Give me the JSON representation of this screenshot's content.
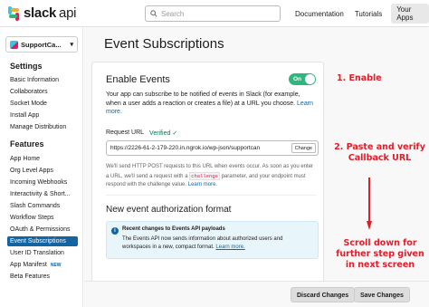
{
  "brand": {
    "name": "slack",
    "suffix": "api"
  },
  "search": {
    "placeholder": "Search"
  },
  "nav": {
    "documentation": "Documentation",
    "tutorials": "Tutorials",
    "your_apps": "Your Apps"
  },
  "app_selector": {
    "name": "SupportCa..."
  },
  "sidebar": {
    "settings_heading": "Settings",
    "settings_items": [
      "Basic Information",
      "Collaborators",
      "Socket Mode",
      "Install App",
      "Manage Distribution"
    ],
    "features_heading": "Features",
    "features_items": [
      "App Home",
      "Org Level Apps",
      "Incoming Webhooks",
      "Interactivity & Short...",
      "Slash Commands",
      "Workflow Steps",
      "OAuth & Permissions",
      "Event Subscriptions",
      "User ID Translation",
      "App Manifest",
      "Beta Features"
    ],
    "new_badge": "NEW"
  },
  "page": {
    "title": "Event Subscriptions"
  },
  "enable_events": {
    "heading": "Enable Events",
    "toggle_label": "On",
    "description": "Your app can subscribe to be notified of events in Slack (for example, when a user adds a reaction or creates a file) at a URL you choose.",
    "learn_more": "Learn more.",
    "request_url_label": "Request URL",
    "verified_label": "Verified",
    "url_value": "https://2226-61-2-179-220.in.ngrok.io/wp-json/supportcan",
    "change_button": "Change",
    "post_desc_1": "We'll send HTTP POST requests to this URL when events occur. As soon as you enter a URL, we'll send a request with a",
    "challenge_code": "challenge",
    "post_desc_2": "parameter, and your endpoint must respond with the challenge value.",
    "learn_more_2": "Learn more."
  },
  "new_format": {
    "heading": "New event authorization format",
    "info_title": "Recent changes to Events API payloads",
    "info_body": "The Events API now sends information about authorized users and workspaces in a new, compact format.",
    "learn_more": "Learn more."
  },
  "annotations": {
    "step1": "1. Enable",
    "step2_line1": "2. Paste and verify",
    "step2_line2": "Callback URL",
    "scroll_line1": "Scroll down for",
    "scroll_line2": "further step given",
    "scroll_line3": "in next screen"
  },
  "footer": {
    "discard": "Discard Changes",
    "save": "Save Changes"
  },
  "colors": {
    "accent": "#1264a3",
    "toggle_on": "#2eb67d",
    "annotation": "#e01e2a"
  }
}
